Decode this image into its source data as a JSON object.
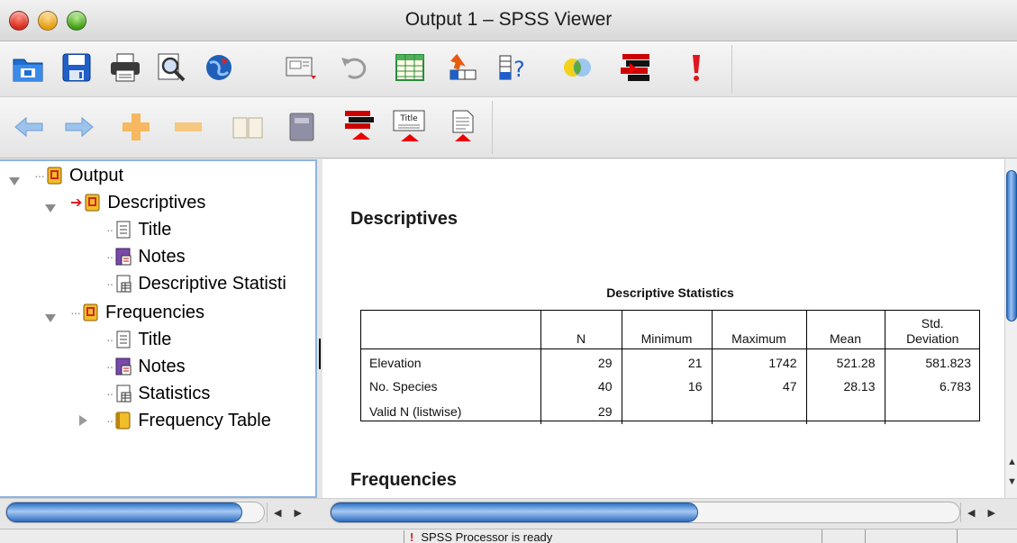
{
  "window": {
    "title": "Output 1 – SPSS Viewer"
  },
  "toolbar1": {
    "icons": [
      "open-folder-icon",
      "save-disk-icon",
      "print-icon",
      "print-preview-icon",
      "export-globe-icon",
      "recall-dialog-icon",
      "undo-icon",
      "goto-data-icon",
      "goto-case-icon",
      "variables-help-icon",
      "use-sets-icon",
      "designate-window-icon",
      "alert-icon"
    ]
  },
  "toolbar2": {
    "icons": [
      "promote-arrow-icon",
      "demote-arrow-icon",
      "expand-plus-icon",
      "collapse-minus-icon",
      "show-book-icon",
      "hide-book-icon",
      "insert-heading-icon",
      "insert-title-icon",
      "insert-text-icon"
    ],
    "title_icon_text": "Title"
  },
  "outline": {
    "root": "Output",
    "descriptives": {
      "label": "Descriptives",
      "children": [
        "Title",
        "Notes",
        "Descriptive Statisti"
      ]
    },
    "frequencies": {
      "label": "Frequencies",
      "children": [
        "Title",
        "Notes",
        "Statistics",
        "Frequency Table"
      ]
    }
  },
  "content": {
    "section1": "Descriptives",
    "table_caption": "Descriptive Statistics",
    "columns": [
      "",
      "N",
      "Minimum",
      "Maximum",
      "Mean",
      "Std.\nDeviation"
    ],
    "col_std_line1": "Std.",
    "col_std_line2": "Deviation",
    "rows": [
      {
        "label": "Elevation",
        "n": "29",
        "min": "21",
        "max": "1742",
        "mean": "521.28",
        "sd": "581.823"
      },
      {
        "label": "No. Species",
        "n": "40",
        "min": "16",
        "max": "47",
        "mean": "28.13",
        "sd": "6.783"
      },
      {
        "label": "Valid N (listwise)",
        "n": "29",
        "min": "",
        "max": "",
        "mean": "",
        "sd": ""
      }
    ],
    "section2": "Frequencies"
  },
  "scroll": {
    "left_arrows": "◂ ▸",
    "right_arrows": "◂ ▸"
  },
  "status": {
    "icon": "!",
    "text": "SPSS Processor  is ready"
  },
  "colors": {
    "selection_blue": "#8fb3de",
    "scroll_thumb": "#2c72c8",
    "alert_red": "#e0161e"
  }
}
